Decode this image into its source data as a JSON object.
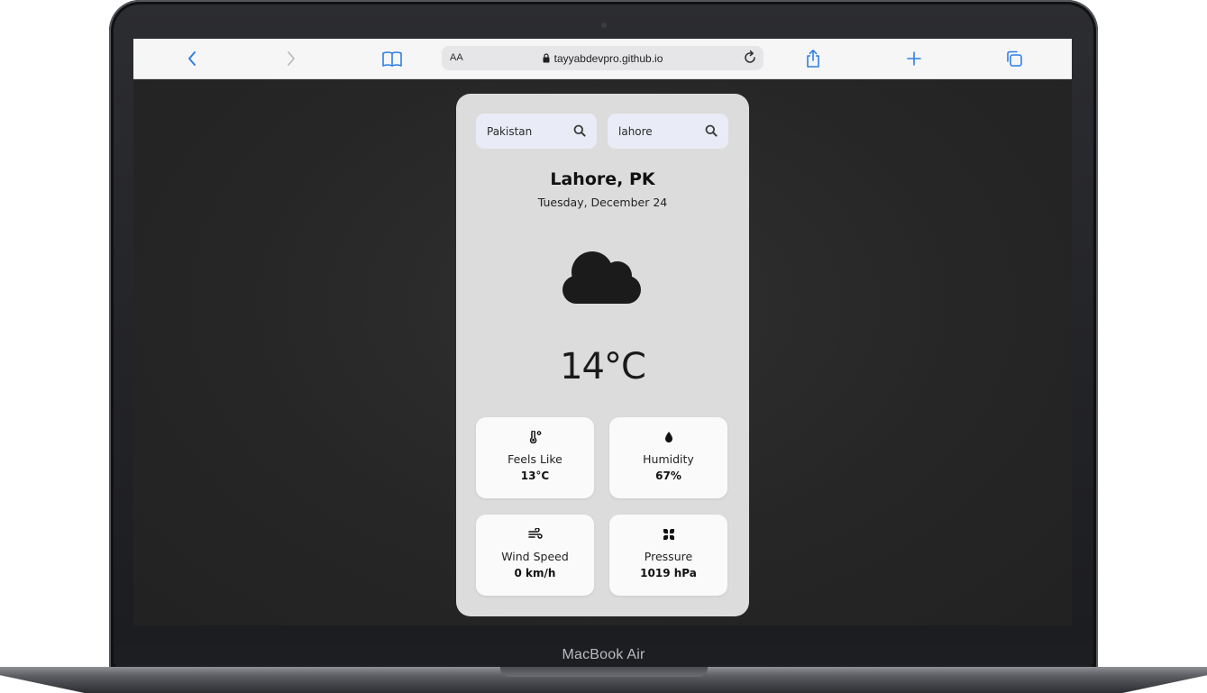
{
  "device": {
    "brand": "MacBook Air"
  },
  "browser": {
    "text_size_label": "AA",
    "url": "tayyabdevpro.github.io",
    "buttons": [
      "back",
      "forward",
      "bookmarks",
      "reload",
      "share",
      "new-tab",
      "tabs"
    ]
  },
  "weather": {
    "country_search": {
      "value": "Pakistan"
    },
    "city_search": {
      "value": "lahore"
    },
    "location": "Lahore, PK",
    "date": "Tuesday, December 24",
    "condition_icon": "cloud-icon",
    "temperature": "14°C",
    "details": [
      {
        "icon": "thermometer-icon",
        "label": "Feels Like",
        "value": "13°C"
      },
      {
        "icon": "droplet-icon",
        "label": "Humidity",
        "value": "67%"
      },
      {
        "icon": "wind-icon",
        "label": "Wind Speed",
        "value": "0 km/h"
      },
      {
        "icon": "pressure-icon",
        "label": "Pressure",
        "value": "1019 hPa"
      }
    ]
  },
  "colors": {
    "browser_accent": "#2f7fe6",
    "page_background": "#262626",
    "card_background": "#dcdcdc",
    "search_background": "#e9ecf6",
    "tile_background": "#fafafa"
  }
}
